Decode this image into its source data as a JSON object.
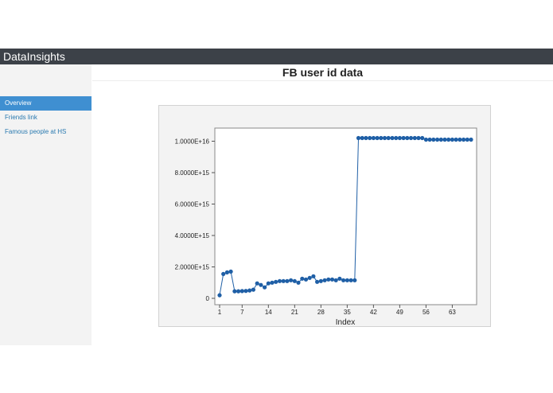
{
  "app": {
    "brand": "DataInsights"
  },
  "sidebar": {
    "items": [
      {
        "label": "Overview",
        "active": true
      },
      {
        "label": "Friends link",
        "active": false
      },
      {
        "label": "Famous people at HS",
        "active": false
      }
    ]
  },
  "main": {
    "title": "FB user id data"
  },
  "colors": {
    "series": "#1f5fa6",
    "topbar": "#3c4148",
    "active_nav": "#3f8fd1"
  },
  "chart_data": {
    "type": "line",
    "xlabel": "Index",
    "ylabel": "",
    "xlim": [
      1,
      68
    ],
    "ylim": [
      0,
      1e+16
    ],
    "x_ticks": [
      1,
      7,
      14,
      21,
      28,
      35,
      42,
      49,
      56,
      63
    ],
    "y_ticks": [
      0,
      2000000000000000.0,
      4000000000000000.0,
      6000000000000000.0,
      8000000000000000.0,
      1e+16
    ],
    "y_tick_labels": [
      "0",
      "2.0000E+15",
      "4.0000E+15",
      "6.0000E+15",
      "8.0000E+15",
      "1.0000E+16"
    ],
    "grid": false,
    "markers": true,
    "series": [
      {
        "values": [
          200000000000000.0,
          1550000000000000.0,
          1650000000000000.0,
          1700000000000000.0,
          450000000000000.0,
          450000000000000.0,
          460000000000000.0,
          470000000000000.0,
          500000000000000.0,
          550000000000000.0,
          950000000000000.0,
          850000000000000.0,
          700000000000000.0,
          950000000000000.0,
          1000000000000000.0,
          1050000000000000.0,
          1100000000000000.0,
          1100000000000000.0,
          1100000000000000.0,
          1150000000000000.0,
          1100000000000000.0,
          1000000000000000.0,
          1250000000000000.0,
          1200000000000000.0,
          1300000000000000.0,
          1400000000000000.0,
          1050000000000000.0,
          1100000000000000.0,
          1150000000000000.0,
          1200000000000000.0,
          1200000000000000.0,
          1150000000000000.0,
          1250000000000000.0,
          1150000000000000.0,
          1150000000000000.0,
          1150000000000000.0,
          1150000000000000.0,
          1.02e+16,
          1.02e+16,
          1.02e+16,
          1.02e+16,
          1.02e+16,
          1.02e+16,
          1.02e+16,
          1.02e+16,
          1.02e+16,
          1.02e+16,
          1.02e+16,
          1.02e+16,
          1.02e+16,
          1.02e+16,
          1.02e+16,
          1.02e+16,
          1.02e+16,
          1.02e+16,
          1.01e+16,
          1.01e+16,
          1.01e+16,
          1.01e+16,
          1.01e+16,
          1.01e+16,
          1.01e+16,
          1.01e+16,
          1.01e+16,
          1.01e+16,
          1.01e+16,
          1.01e+16,
          1.01e+16
        ]
      }
    ]
  }
}
